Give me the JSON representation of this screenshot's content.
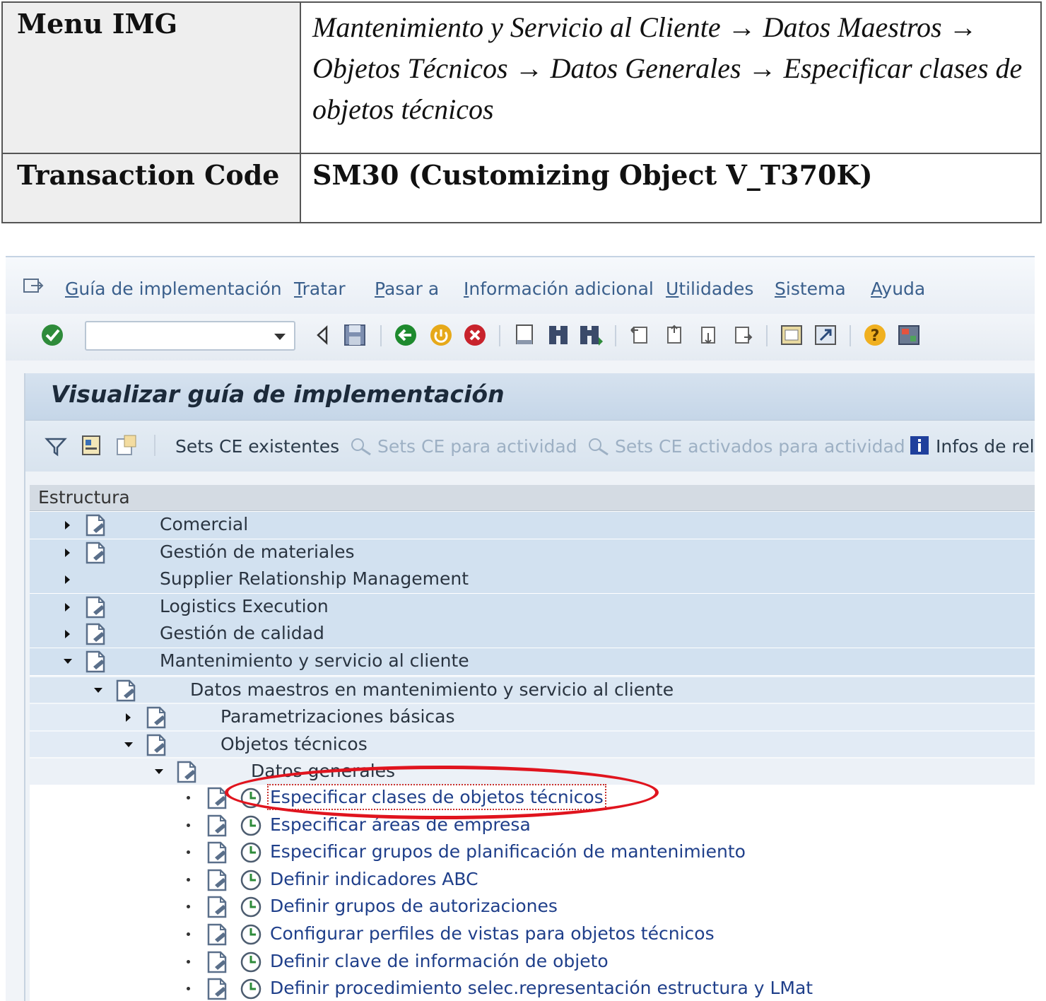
{
  "info_table": {
    "menu_label": "Menu IMG",
    "menu_path": "Mantenimiento y Servicio al Cliente → Datos Maestros → Objetos Técnicos → Datos Generales → Especificar clases de objetos técnicos",
    "tcode_label": "Transaction Code",
    "tcode_value": "SM30 (Customizing Object V_T370K)"
  },
  "menubar": {
    "items": [
      "Guía de implementación",
      "Tratar",
      "Pasar a",
      "Información adicional",
      "Utilidades",
      "Sistema",
      "Ayuda"
    ]
  },
  "toolbar": {
    "command_value": "",
    "icons": [
      "enter-icon",
      "back-arrow-icon",
      "save-icon",
      "green-back-icon",
      "exit-icon",
      "cancel-icon",
      "print-icon",
      "find-icon",
      "find-next-icon",
      "first-page-icon",
      "prev-page-icon",
      "next-page-icon",
      "last-page-icon",
      "create-session-icon",
      "shortcut-icon",
      "help-icon",
      "layout-icon"
    ]
  },
  "page_title": "Visualizar guía de implementación",
  "app_toolbar": {
    "sets_ce_existentes": "Sets CE existentes",
    "sets_ce_actividad": "Sets CE para actividad",
    "sets_ce_activados": "Sets CE activados para actividad",
    "infos_release": "Infos de rel"
  },
  "tree": {
    "header": "Estructura",
    "rows": [
      {
        "label": "Comercial",
        "level": 0,
        "state": "collapsed",
        "doc": true
      },
      {
        "label": "Gestión de materiales",
        "level": 0,
        "state": "collapsed",
        "doc": true
      },
      {
        "label": "Supplier Relationship Management",
        "level": 0,
        "state": "collapsed",
        "doc": false
      },
      {
        "label": "Logistics Execution",
        "level": 0,
        "state": "collapsed",
        "doc": true
      },
      {
        "label": "Gestión de calidad",
        "level": 0,
        "state": "collapsed",
        "doc": true
      },
      {
        "label": "Mantenimiento y servicio al cliente",
        "level": 0,
        "state": "expanded",
        "doc": true
      },
      {
        "label": "Datos maestros en mantenimiento y servicio al cliente",
        "level": 1,
        "state": "expanded",
        "doc": true
      },
      {
        "label": "Parametrizaciones básicas",
        "level": 2,
        "state": "collapsed",
        "doc": true
      },
      {
        "label": "Objetos técnicos",
        "level": 2,
        "state": "expanded",
        "doc": true
      },
      {
        "label": "Datos generales",
        "level": 3,
        "state": "expanded",
        "doc": true
      },
      {
        "label": "Especificar clases de objetos técnicos",
        "level": 4,
        "state": "leaf",
        "doc": true,
        "selected": true
      },
      {
        "label": "Especificar áreas de empresa",
        "level": 4,
        "state": "leaf",
        "doc": true
      },
      {
        "label": "Especificar grupos de planificación de mantenimiento",
        "level": 4,
        "state": "leaf",
        "doc": true
      },
      {
        "label": "Definir indicadores ABC",
        "level": 4,
        "state": "leaf",
        "doc": true
      },
      {
        "label": "Definir grupos de autorizaciones",
        "level": 4,
        "state": "leaf",
        "doc": true
      },
      {
        "label": "Configurar perfiles de vistas para objetos técnicos",
        "level": 4,
        "state": "leaf",
        "doc": true
      },
      {
        "label": "Definir clave de información de objeto",
        "level": 4,
        "state": "leaf",
        "doc": true
      },
      {
        "label": "Definir procedimiento selec.representación estructura y LMat",
        "level": 4,
        "state": "leaf",
        "doc": true
      }
    ]
  },
  "colors": {
    "menu_text": "#3a5f8c",
    "highlight": "#e0141e",
    "leaf_text": "#1f3f8a"
  }
}
